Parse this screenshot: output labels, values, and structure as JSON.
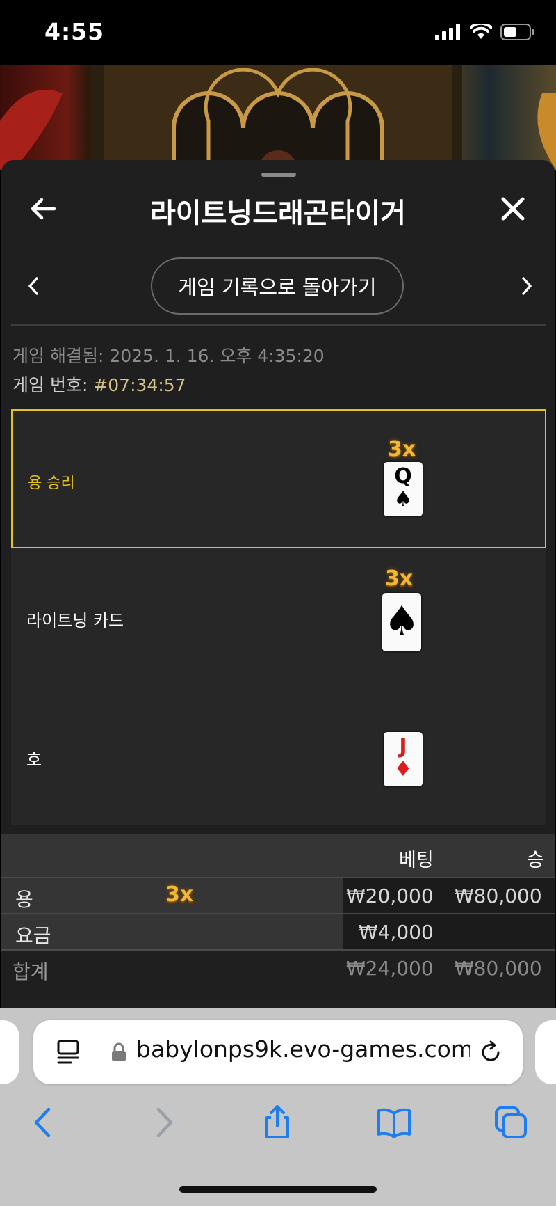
{
  "status_bar": {
    "time": "4:55"
  },
  "header": {
    "title": "라이트닝드래곤타이거",
    "back_history_label": "게임 기록으로 돌아가기"
  },
  "info": {
    "resolved_label": "게임 해결됨: 2025. 1. 16. 오후 4:35:20",
    "game_number_label": "게임 번호: ",
    "game_number": "#07:34:57"
  },
  "results": [
    {
      "label": "용 승리",
      "multiplier": "3x",
      "card_rank": "Q",
      "card_suit": "♠"
    },
    {
      "label": "라이트닝 카드",
      "multiplier": "3x",
      "card_suit": "♠"
    },
    {
      "label": "호",
      "card_rank": "J",
      "card_suit": "♦"
    }
  ],
  "bet_table": {
    "headers": {
      "bet": "베팅",
      "win": "승"
    },
    "rows": [
      {
        "name": "용",
        "multiplier": "3x",
        "bet": "₩20,000",
        "win": "₩80,000"
      },
      {
        "name": "요금",
        "bet": "₩4,000",
        "win": ""
      }
    ],
    "total": {
      "name": "합계",
      "bet": "₩24,000",
      "win": "₩80,000"
    }
  },
  "browser": {
    "url": "babylonps9k.evo-games.com"
  },
  "colors": {
    "accent": "#e6c21f",
    "multiplier_gold": "#f2b736",
    "ios_blue": "#1c7ef0"
  }
}
